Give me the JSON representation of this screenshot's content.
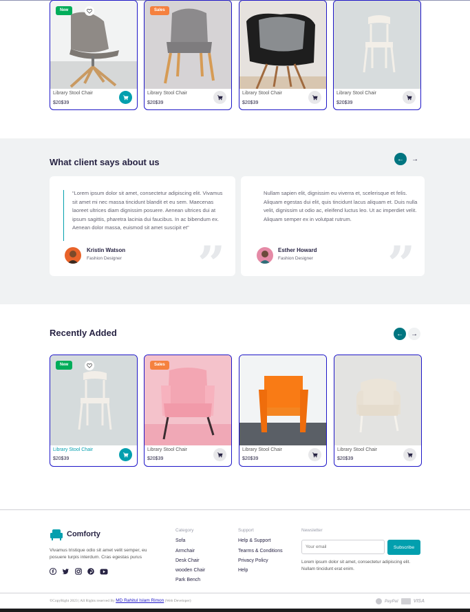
{
  "top_products": [
    {
      "name": "Library Stool Chair",
      "price": "$20$39",
      "badge": "New",
      "cart_active": true
    },
    {
      "name": "Library Stool Chair",
      "price": "$20$39",
      "badge": "Sales",
      "cart_active": false
    },
    {
      "name": "Library Stool Chair",
      "price": "$20$39",
      "badge": "",
      "cart_active": false
    },
    {
      "name": "Library Stool Chair",
      "price": "$20$39",
      "badge": "",
      "cart_active": false
    }
  ],
  "testimonials": {
    "title": "What client says about us",
    "items": [
      {
        "quote": "“Lorem ipsum dolor sit amet, consectetur adipiscing elit. Vivamus sit amet mi nec massa tincidunt blandit et eu sem. Maecenas laoreet ultrices diam dignissim posuere. Aenean ultrices dui at ipsum sagittis, pharetra lacinia dui faucibus. In ac bibendum ex. Aenean dolor massa, euismod sit amet suscipit et”",
        "name": "Kristin Watson",
        "role": "Fashion Designer"
      },
      {
        "quote": "Nullam sapien elit, dignissim eu viverra et, scelerisque et felis. Aliquam egestas dui elit, quis tincidunt lacus aliquam et. Duis nulla velit, dignissim ut odio ac, eleifend luctus leo. Ut ac imperdiet velit. Aliquam semper ex in volutpat rutrum.",
        "name": "Esther Howard",
        "role": "Fashion Designer"
      }
    ]
  },
  "recent": {
    "title": "Recently Added",
    "products": [
      {
        "name": "Library Stool Chair",
        "price": "$20$39",
        "badge": "New",
        "cart_active": true
      },
      {
        "name": "Library Stool Chair",
        "price": "$20$39",
        "badge": "Sales",
        "cart_active": false
      },
      {
        "name": "Library Stool Chair",
        "price": "$20$39",
        "badge": "",
        "cart_active": false
      },
      {
        "name": "Library Stool Chair",
        "price": "$20$39",
        "badge": "",
        "cart_active": false
      }
    ]
  },
  "footer": {
    "brand": "Comforty",
    "description": "Vivamus tristique odio sit amet velit semper, eu posuere turpis interdum. Cras egestas purus",
    "category_label": "Category",
    "categories": [
      "Sofa",
      "Armchair",
      "Desk Chair",
      "wooden Chair",
      "Park Bench"
    ],
    "support_label": "Support",
    "support": [
      "Help & Support",
      "Tearms & Conditions",
      "Privacy Policy",
      "Help"
    ],
    "newsletter_label": "Newsletter",
    "email_placeholder": "Your email",
    "subscribe": "Subscribe",
    "newsletter_text": "Lorem ipsum dolor sit amet, consectetur adipiscing elit. Nullam tincidunt erat enim.",
    "copyright_prefix": "©CopyRight 2023 | All Rights reserved By",
    "copyright_author": "MD Rahitul Islam Rimon",
    "copyright_suffix": "(Web Developer)",
    "payments": [
      "PayPal",
      "VISA"
    ]
  },
  "colors": {
    "accent": "#029fae",
    "dark_teal": "#007580",
    "card_border": "#1c14c7",
    "new_badge": "#01ad5a",
    "sale_badge": "#f5813f"
  }
}
